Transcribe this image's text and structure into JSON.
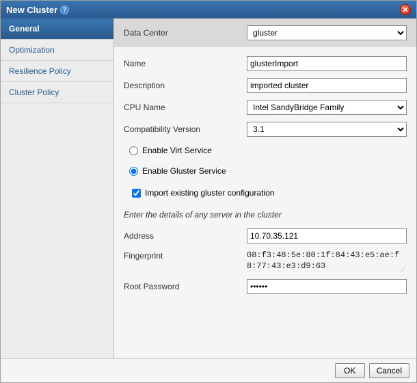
{
  "dialog": {
    "title": "New Cluster"
  },
  "sidebar": {
    "items": [
      {
        "label": "General",
        "active": true
      },
      {
        "label": "Optimization",
        "active": false
      },
      {
        "label": "Resilience Policy",
        "active": false
      },
      {
        "label": "Cluster Policy",
        "active": false
      }
    ]
  },
  "form": {
    "data_center": {
      "label": "Data Center",
      "value": "gluster"
    },
    "name": {
      "label": "Name",
      "value": "glusterImport"
    },
    "description": {
      "label": "Description",
      "value": "imported cluster"
    },
    "cpu_name": {
      "label": "CPU Name",
      "value": "Intel SandyBridge Family"
    },
    "compat_version": {
      "label": "Compatibility Version",
      "value": "3.1"
    },
    "service": {
      "virt_label": "Enable Virt Service",
      "gluster_label": "Enable Gluster Service",
      "selected": "gluster"
    },
    "import_existing": {
      "label": "Import existing gluster configuration",
      "checked": true
    },
    "hint": "Enter the details of any server in the cluster",
    "address": {
      "label": "Address",
      "value": "10.70.35.121"
    },
    "fingerprint": {
      "label": "Fingerprint",
      "value": "08:f3:48:5e:80:1f:84:43:e5:ae:f8:77:43:e3:d9:63"
    },
    "root_password": {
      "label": "Root Password",
      "value": "••••••"
    }
  },
  "footer": {
    "ok": "OK",
    "cancel": "Cancel"
  }
}
